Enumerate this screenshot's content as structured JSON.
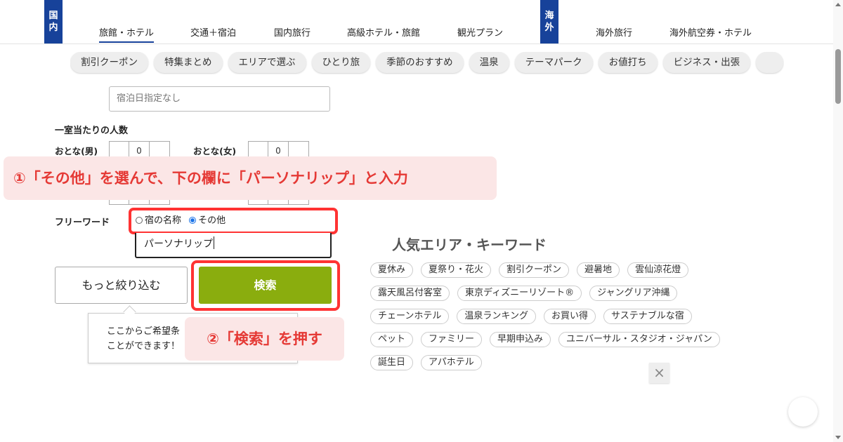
{
  "nav": {
    "domestic_badge": [
      "国",
      "内"
    ],
    "overseas_badge": [
      "海",
      "外"
    ],
    "tabs": [
      "旅館・ホテル",
      "交通＋宿泊",
      "国内旅行",
      "高級ホテル・旅館",
      "観光プラン",
      "海外旅行",
      "海外航空券・ホテル"
    ],
    "active_tab": "旅館・ホテル"
  },
  "chips": [
    "割引クーポン",
    "特集まとめ",
    "エリアで選ぶ",
    "ひとり旅",
    "季節のおすすめ",
    "温泉",
    "テーマパーク",
    "お値打ち",
    "ビジネス・出張"
  ],
  "form": {
    "date_placeholder": "宿泊日指定なし",
    "guests_label": "一室当たりの人数",
    "adult_male_label": "おとな(男)",
    "adult_male_value": "0",
    "adult_female_label": "おとな(女)",
    "adult_female_value": "0",
    "freeword_label": "フリーワード",
    "radio_name_label": "宿の名称",
    "radio_other_label": "その他",
    "radio_selected": "その他",
    "freeword_value": "パーソナリップ",
    "more_button": "もっと絞り込む",
    "search_button": "検索",
    "tooltip_line1": "ここからご希望条",
    "tooltip_line2": "ことができます！"
  },
  "annotations": {
    "step1": "①「その他」を選んで、下の欄に「パーソナリップ」と入力",
    "step2": "②「検索」を押す"
  },
  "popular": {
    "title": "人気エリア・キーワード",
    "rows": [
      [
        "夏休み",
        "夏祭り・花火",
        "割引クーポン",
        "避暑地",
        "雲仙涼花燈"
      ],
      [
        "露天風呂付客室",
        "東京ディズニーリゾート®",
        "ジャングリア沖縄"
      ],
      [
        "チェーンホテル",
        "温泉ランキング",
        "お買い得",
        "サステナブルな宿"
      ],
      [
        "ペット",
        "ファミリー",
        "早期申込み",
        "ユニバーサル・スタジオ・ジャパン"
      ],
      [
        "誕生日",
        "アパホテル"
      ]
    ]
  },
  "close_label": "×",
  "colors": {
    "navy": "#17429a",
    "search_green": "#8aad0e",
    "annotation_red": "#e53935",
    "highlight_border": "#ff3333"
  }
}
